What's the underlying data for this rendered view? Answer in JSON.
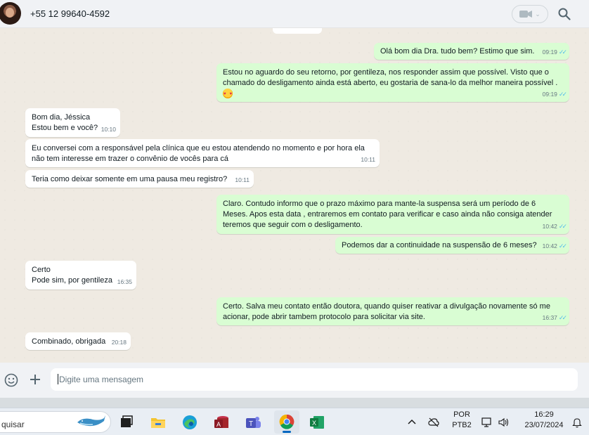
{
  "header": {
    "contact_name": "+55 12 99640-4592"
  },
  "messages": [
    {
      "dir": "out",
      "text": "Olá bom dia Dra. tudo bem? Estimo que sim.",
      "time": "09:19"
    },
    {
      "dir": "out",
      "text": "Estou no aguardo do seu retorno, por gentileza, nos responder assim que possível. Visto que o chamado do desligamento ainda está aberto, eu gostaria de sana-lo da melhor maneira possível .",
      "time": "09:19",
      "emoji": "smiling-face-with-hearts"
    },
    {
      "dir": "in",
      "text_lines": [
        "Bom dia, Jéssica",
        "Estou bem e você?"
      ],
      "time": "10:10"
    },
    {
      "dir": "in",
      "text_lines": [
        "Eu conversei com a responsável pela clínica que eu estou atendendo no momento e por hora ela",
        "não tem interesse em trazer o convênio de vocês para cá"
      ],
      "time": "10:11"
    },
    {
      "dir": "in",
      "text": "Teria como deixar somente em uma pausa meu registro?",
      "time": "10:11"
    },
    {
      "dir": "out",
      "text_lines": [
        "Claro. Contudo informo que o prazo máximo para mante-la suspensa será um período de 6",
        "Meses. Apos esta data , entraremos em contato para verificar e caso ainda não consiga atender",
        "teremos que seguir com o desligamento."
      ],
      "time": "10:42"
    },
    {
      "dir": "out",
      "text": "Podemos dar a continuidade na suspensão de 6 meses?",
      "time": "10:42"
    },
    {
      "dir": "in",
      "text_lines": [
        "Certo",
        "Pode sim, por gentileza"
      ],
      "time": "16:35"
    },
    {
      "dir": "out",
      "text_lines": [
        "Certo. Salva meu contato então doutora, quando quiser reativar a divulgação novamente só me",
        "acionar, pode abrir tambem protocolo para solicitar via site."
      ],
      "time": "16:37"
    },
    {
      "dir": "in",
      "text": "Combinado, obrigada",
      "time": "20:18"
    }
  ],
  "composer": {
    "placeholder": "Digite uma mensagem"
  },
  "taskbar": {
    "search_text": "quisar",
    "language": "POR",
    "keyboard": "PTB2",
    "clock_time": "16:29",
    "clock_date": "23/07/2024"
  },
  "colors": {
    "outgoing_bubble": "#d9fdd3",
    "incoming_bubble": "#ffffff",
    "chat_background": "#efeae2",
    "read_ticks": "#53bdeb"
  },
  "icons": [
    "avatar",
    "video-call-icon",
    "chevron-down-icon",
    "search-icon",
    "emoji-icon",
    "plus-icon",
    "whale-icon",
    "task-view-icon",
    "file-explorer-icon",
    "edge-icon",
    "access-icon",
    "teams-icon",
    "chrome-icon",
    "excel-icon",
    "chevron-up-icon",
    "cloud-off-icon",
    "display-icon",
    "volume-icon",
    "bell-icon"
  ]
}
